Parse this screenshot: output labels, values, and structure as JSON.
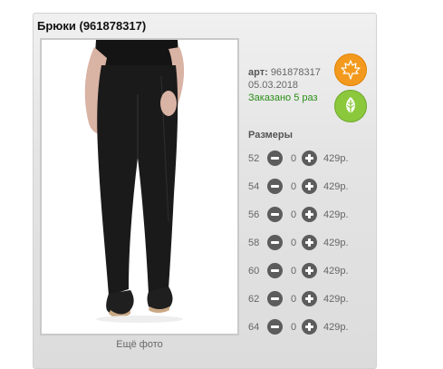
{
  "product": {
    "title": "Брюки (961878317)",
    "more_photos": "Ещё фото",
    "sku_label": "арт:",
    "sku": "961878317",
    "date": "05.03.2018",
    "ordered": "Заказано 5 раз"
  },
  "badges": [
    {
      "icon": "maple-leaf-icon",
      "color": "#f39a1e"
    },
    {
      "icon": "leaf-icon",
      "color": "#8cc83c"
    }
  ],
  "sizes": {
    "title": "Размеры",
    "rows": [
      {
        "size": "52",
        "qty": "0",
        "price": "429р."
      },
      {
        "size": "54",
        "qty": "0",
        "price": "429р."
      },
      {
        "size": "56",
        "qty": "0",
        "price": "429р."
      },
      {
        "size": "58",
        "qty": "0",
        "price": "429р."
      },
      {
        "size": "60",
        "qty": "0",
        "price": "429р."
      },
      {
        "size": "62",
        "qty": "0",
        "price": "429р."
      },
      {
        "size": "64",
        "qty": "0",
        "price": "429р."
      }
    ]
  }
}
